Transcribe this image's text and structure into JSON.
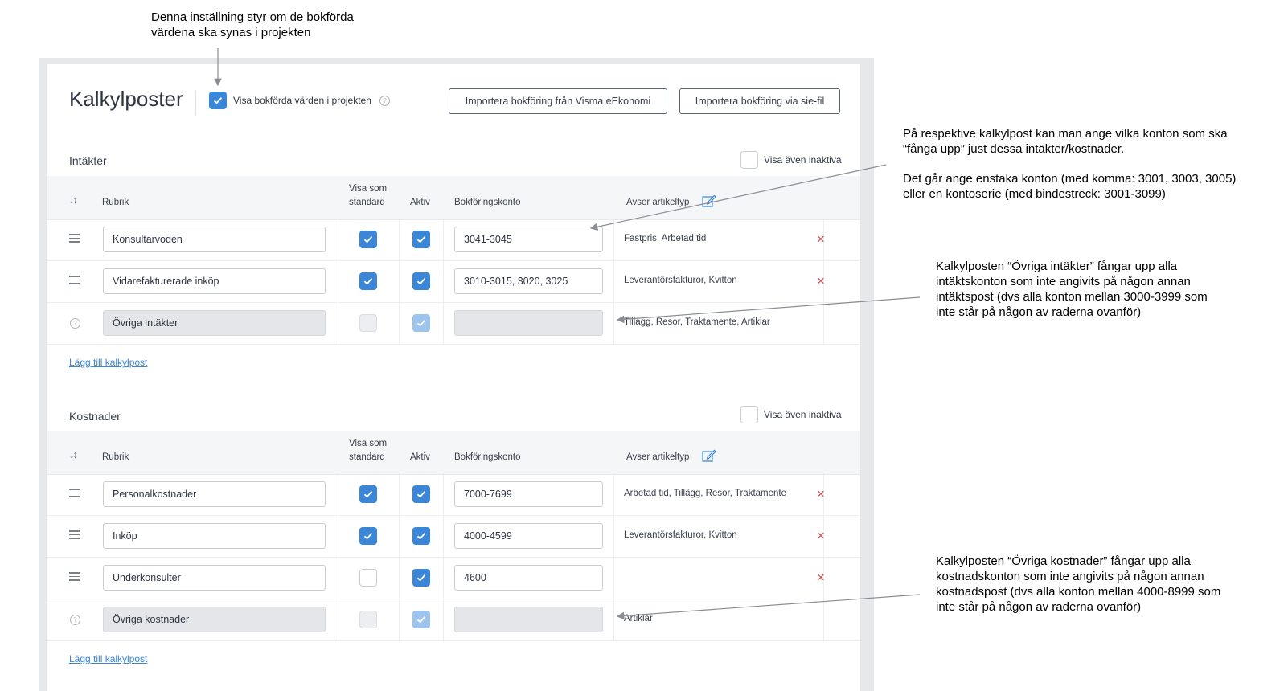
{
  "annotations": {
    "top_note": "Denna inställning styr om de bokförda värdena ska synas i projekten",
    "accounts_note_1": "På respektive kalkylpost kan man ange vilka konton som ska “fånga upp” just dessa intäkter/kostnader.",
    "accounts_note_2": "Det går ange enstaka konton (med komma: 3001, 3003, 3005) eller en kontoserie (med bindestreck: 3001-3099)",
    "ovriga_intakter_note": "Kalkylposten “Övriga intäkter” fångar upp alla intäktskonton som inte angivits på någon annan intäktspost (dvs alla konton mellan 3000-3999 som inte står på någon av raderna ovanför)",
    "ovriga_kostnader_note": "Kalkylposten “Övriga kostnader” fångar upp alla kostnadskonton som inte angivits på någon annan kostnadspost (dvs alla konton mellan 4000-8999 som inte står på någon av raderna ovanför)"
  },
  "header": {
    "title": "Kalkylposter",
    "show_booked_label": "Visa bokförda värden i projekten",
    "show_booked_checked": true,
    "import_visma_label": "Importera bokföring från Visma eEkonomi",
    "import_sie_label": "Importera bokföring via sie-fil"
  },
  "columns": {
    "rubrik": "Rubrik",
    "visa_som_line1": "Visa som",
    "visa_som_line2": "standard",
    "aktiv": "Aktiv",
    "konto": "Bokföringskonto",
    "artikeltyp": "Avser artikeltyp"
  },
  "intakter": {
    "title": "Intäkter",
    "show_inactive_label": "Visa även inaktiva",
    "add_link": "Lägg till kalkylpost",
    "rows": [
      {
        "rubrik": "Konsultarvoden",
        "standard": true,
        "aktiv": true,
        "konto": "3041-3045",
        "artikeltyp": "Fastpris, Arbetad tid"
      },
      {
        "rubrik": "Vidarefakturerade inköp",
        "standard": true,
        "aktiv": true,
        "konto": "3010-3015, 3020, 3025",
        "artikeltyp": "Leverantörsfakturor, Kvitton"
      },
      {
        "rubrik": "Övriga intäkter",
        "standard": false,
        "aktiv": true,
        "konto": "",
        "artikeltyp": "Tillägg, Resor, Traktamente, Artiklar",
        "system": true
      }
    ]
  },
  "kostnader": {
    "title": "Kostnader",
    "show_inactive_label": "Visa även inaktiva",
    "add_link": "Lägg till kalkylpost",
    "rows": [
      {
        "rubrik": "Personalkostnader",
        "standard": true,
        "aktiv": true,
        "konto": "7000-7699",
        "artikeltyp": "Arbetad tid, Tillägg, Resor, Traktamente"
      },
      {
        "rubrik": "Inköp",
        "standard": true,
        "aktiv": true,
        "konto": "4000-4599",
        "artikeltyp": "Leverantörsfakturor, Kvitton"
      },
      {
        "rubrik": "Underkonsulter",
        "standard": false,
        "aktiv": true,
        "konto": "4600",
        "artikeltyp": ""
      },
      {
        "rubrik": "Övriga kostnader",
        "standard": false,
        "aktiv": true,
        "konto": "",
        "artikeltyp": "Artiklar",
        "system": true
      }
    ]
  },
  "icons": {
    "delete": "×",
    "help": "?",
    "sort": "↓↕"
  },
  "colors": {
    "accent": "#3b86d6",
    "delete": "#e0474c",
    "link": "#3b86d6"
  }
}
